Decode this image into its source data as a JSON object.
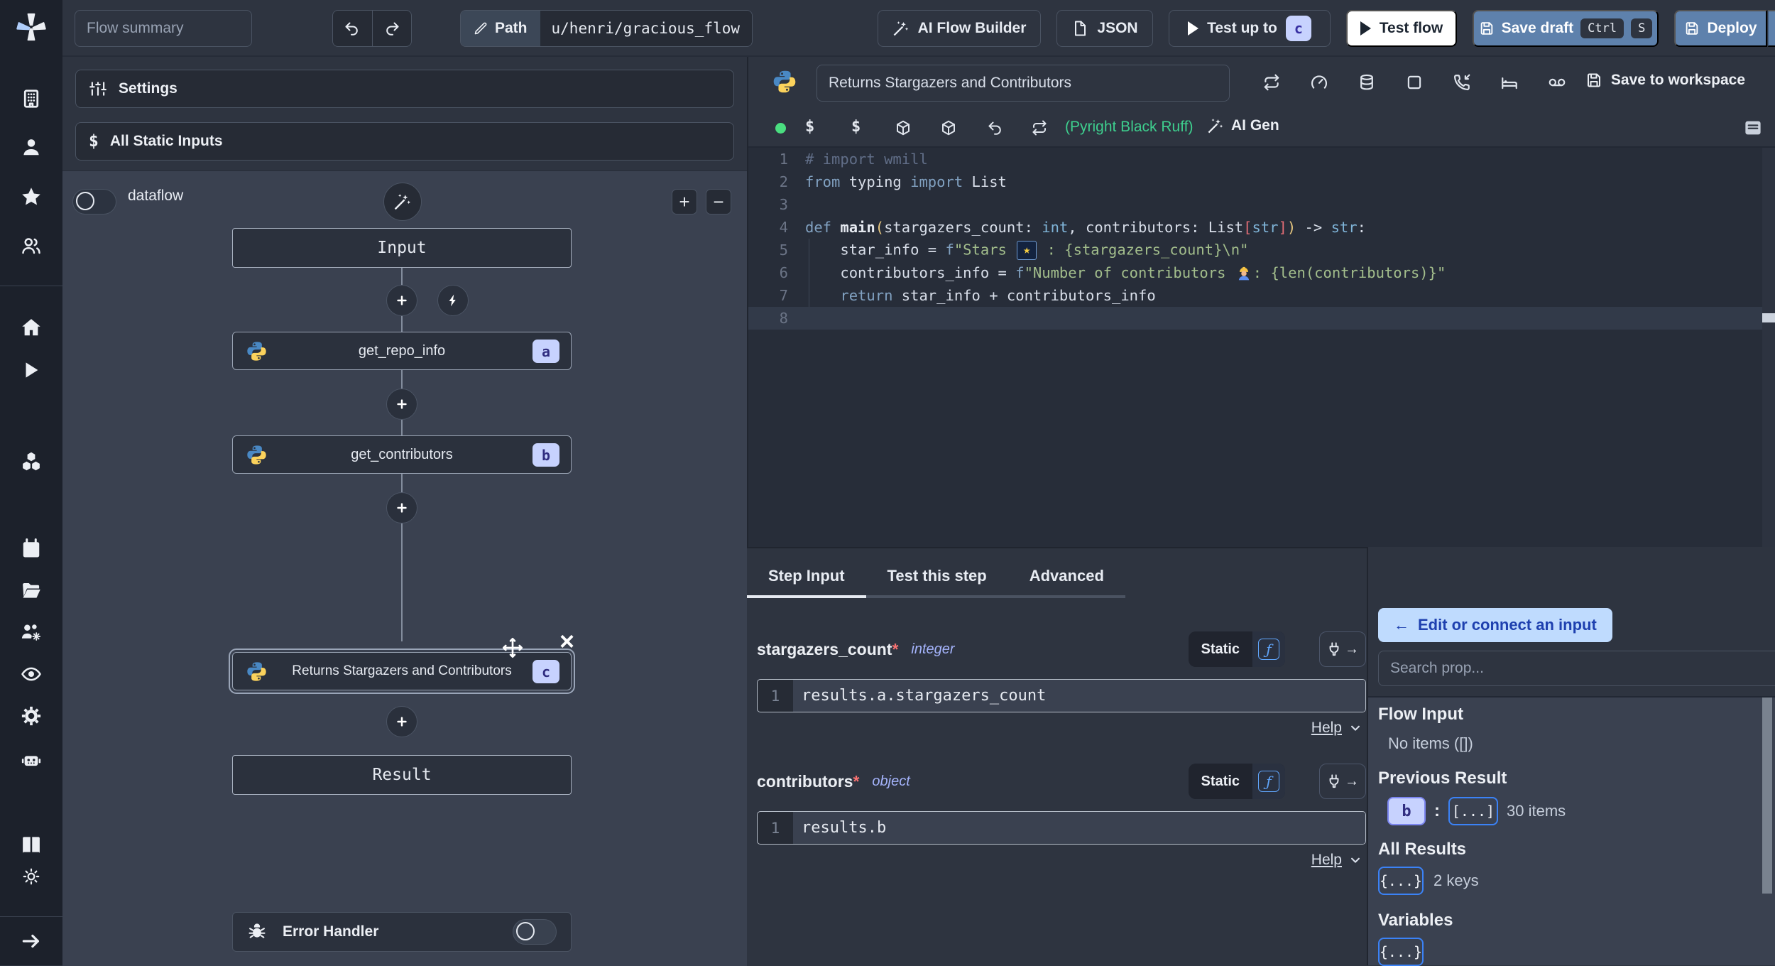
{
  "topbar": {
    "flow_summary_placeholder": "Flow summary",
    "path_label": "Path",
    "path_value": "u/henri/gracious_flow",
    "ai_flow_builder": "AI Flow Builder",
    "json_button": "JSON",
    "test_up_to": "Test up to",
    "test_up_to_badge": "c",
    "test_flow": "Test flow",
    "save_draft": "Save draft",
    "save_draft_kbd": [
      "Ctrl",
      "S"
    ],
    "deploy": "Deploy"
  },
  "flow_panel": {
    "settings": "Settings",
    "all_static_inputs": "All Static Inputs",
    "dataflow_label": "dataflow",
    "input_node": "Input",
    "steps": [
      {
        "label": "get_repo_info",
        "badge": "a"
      },
      {
        "label": "get_contributors",
        "badge": "b"
      },
      {
        "label": "Returns Stargazers and Contributors",
        "badge": "c"
      }
    ],
    "result_node": "Result",
    "error_handler": "Error Handler"
  },
  "editor": {
    "title": "Returns Stargazers and Contributors",
    "lint_status": "(Pyright Black Ruff)",
    "ai_gen": "AI Gen",
    "save_to_workspace": "Save to workspace",
    "current_line": 8,
    "code_lines": [
      {
        "n": 1,
        "tokens": [
          {
            "text": "# import wmill",
            "type": "comment"
          }
        ]
      },
      {
        "n": 2,
        "tokens": [
          {
            "text": "from",
            "type": "kw"
          },
          {
            "text": " typing ",
            "type": "plain"
          },
          {
            "text": "import",
            "type": "kw"
          },
          {
            "text": " List",
            "type": "plain"
          }
        ]
      },
      {
        "n": 3,
        "tokens": []
      },
      {
        "n": 4,
        "tokens": [
          {
            "text": "def ",
            "type": "kw"
          },
          {
            "text": "main",
            "type": "fn"
          },
          {
            "text": "(",
            "type": "paren"
          },
          {
            "text": "stargazers_count: ",
            "type": "plain"
          },
          {
            "text": "int",
            "type": "type"
          },
          {
            "text": ", contributors: List",
            "type": "plain"
          },
          {
            "text": "[",
            "type": "bracket"
          },
          {
            "text": "str",
            "type": "type"
          },
          {
            "text": "]",
            "type": "bracket"
          },
          {
            "text": ")",
            "type": "paren"
          },
          {
            "text": " -> ",
            "type": "plain"
          },
          {
            "text": "str",
            "type": "type"
          },
          {
            "text": ":",
            "type": "plain"
          }
        ]
      },
      {
        "n": 5,
        "tokens": [
          {
            "text": "    star_info = ",
            "type": "plain"
          },
          {
            "text": "f",
            "type": "kw"
          },
          {
            "text": "\"Stars ",
            "type": "str"
          },
          {
            "text": "⭐",
            "type": "emoji-star"
          },
          {
            "text": " : {stargazers_count}\\n\"",
            "type": "str"
          }
        ]
      },
      {
        "n": 6,
        "tokens": [
          {
            "text": "    contributors_info = ",
            "type": "plain"
          },
          {
            "text": "f",
            "type": "kw"
          },
          {
            "text": "\"Number of contributors ",
            "type": "str"
          },
          {
            "text": "👷",
            "type": "emoji-worker"
          },
          {
            "text": ": {len(contributors)}\"",
            "type": "str"
          }
        ]
      },
      {
        "n": 7,
        "tokens": [
          {
            "text": "    ",
            "type": "plain"
          },
          {
            "text": "return",
            "type": "kw"
          },
          {
            "text": " star_info + contributors_info",
            "type": "plain"
          }
        ]
      },
      {
        "n": 8,
        "tokens": []
      }
    ]
  },
  "step_panel": {
    "tabs": [
      "Step Input",
      "Test this step",
      "Advanced"
    ],
    "active_tab": "Step Input",
    "fields": [
      {
        "name": "stargazers_count",
        "required": "*",
        "type": "integer",
        "mode": "Static",
        "line_no": "1",
        "value": "results.a.stargazers_count",
        "help": "Help"
      },
      {
        "name": "contributors",
        "required": "*",
        "type": "object",
        "mode": "Static",
        "line_no": "1",
        "value": "results.b",
        "help": "Help"
      }
    ]
  },
  "right_panel": {
    "edit_connect": "Edit or connect an input",
    "back_arrow": "←",
    "search_placeholder": "Search prop...",
    "flow_input_heading": "Flow Input",
    "flow_input_empty": "No items ([])",
    "previous_result_heading": "Previous Result",
    "previous_result_badge": "b",
    "separator": ":",
    "previous_result_chip": "[...]",
    "previous_result_count": "30 items",
    "all_results_heading": "All Results",
    "all_results_chip": "{...}",
    "all_results_count": "2 keys",
    "variables_heading": "Variables",
    "variables_chip": "{...}"
  },
  "colors": {
    "accent_steel_blue": "#5e81ac",
    "badge_bg": "#c7d2fe",
    "badge_text": "#312e81",
    "lint_green": "#3ecf8e",
    "status_green": "#4ade80",
    "link_blue": "#1e40af",
    "chip_border": "#3b82f6",
    "required_red": "#f87171",
    "type_purple": "#a5b4fc"
  }
}
